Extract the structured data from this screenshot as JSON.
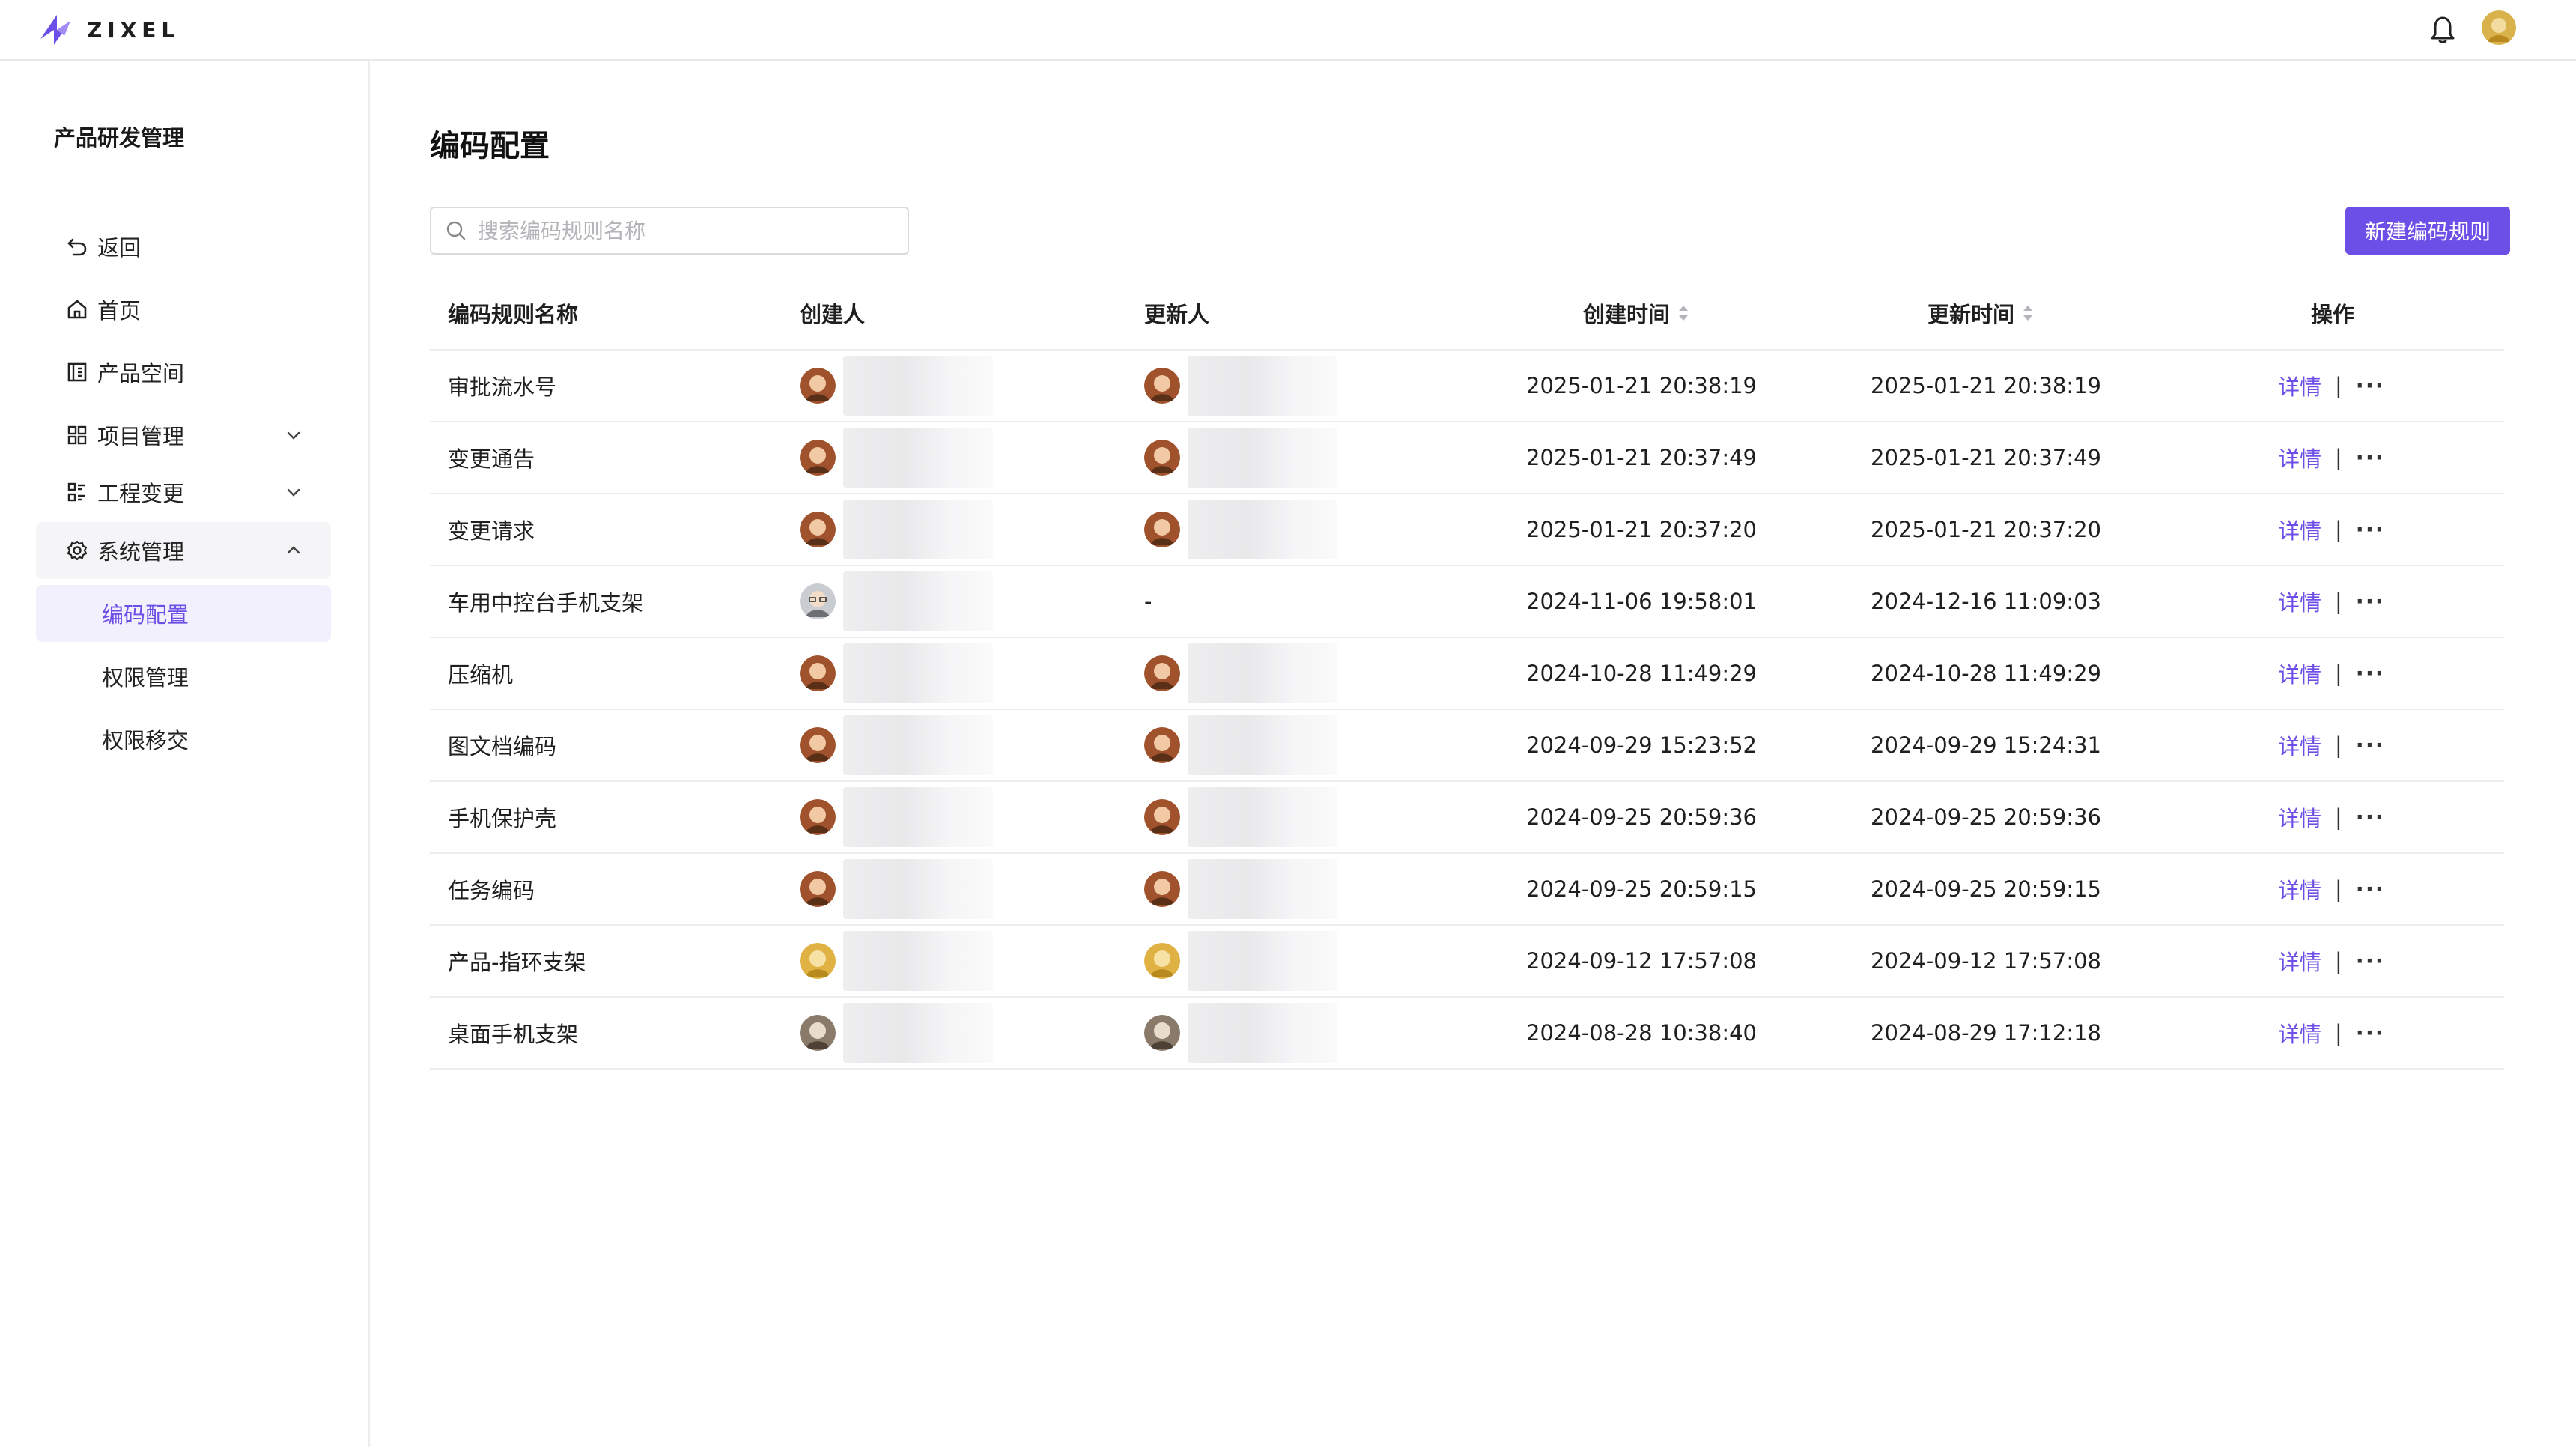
{
  "app": {
    "brand": "ZIXEL"
  },
  "sidebar": {
    "title": "产品研发管理",
    "items": [
      {
        "label": "返回",
        "icon": "undo-icon"
      },
      {
        "label": "首页",
        "icon": "home-icon"
      },
      {
        "label": "产品空间",
        "icon": "product-space-icon"
      },
      {
        "label": "项目管理",
        "icon": "grid-icon",
        "expandable": true,
        "expanded": false
      },
      {
        "label": "工程变更",
        "icon": "list-icon",
        "expandable": true,
        "expanded": false
      },
      {
        "label": "系统管理",
        "icon": "gear-icon",
        "expandable": true,
        "expanded": true
      }
    ],
    "subitems": [
      {
        "label": "编码配置",
        "selected": true
      },
      {
        "label": "权限管理",
        "selected": false
      },
      {
        "label": "权限移交",
        "selected": false
      }
    ]
  },
  "main": {
    "title": "编码配置",
    "search_placeholder": "搜索编码规则名称",
    "new_button": "新建编码规则",
    "columns": [
      "编码规则名称",
      "创建人",
      "更新人",
      "创建时间",
      "更新时间",
      "操作"
    ],
    "detail_label": "详情",
    "separator": "|",
    "more_label": "···",
    "rows": [
      {
        "name": "审批流水号",
        "creator_avatar": "brown",
        "updater_avatar": "brown",
        "updater": "",
        "created": "2025-01-21 20:38:19",
        "updated": "2025-01-21 20:38:19"
      },
      {
        "name": "变更通告",
        "creator_avatar": "brown",
        "updater_avatar": "brown",
        "updater": "",
        "created": "2025-01-21 20:37:49",
        "updated": "2025-01-21 20:37:49"
      },
      {
        "name": "变更请求",
        "creator_avatar": "brown",
        "updater_avatar": "brown",
        "updater": "",
        "created": "2025-01-21 20:37:20",
        "updated": "2025-01-21 20:37:20"
      },
      {
        "name": "车用中控台手机支架",
        "creator_avatar": "glasses",
        "updater_avatar": "",
        "updater": "-",
        "created": "2024-11-06 19:58:01",
        "updated": "2024-12-16 11:09:03"
      },
      {
        "name": "压缩机",
        "creator_avatar": "brown",
        "updater_avatar": "brown",
        "updater": "",
        "created": "2024-10-28 11:49:29",
        "updated": "2024-10-28 11:49:29"
      },
      {
        "name": "图文档编码",
        "creator_avatar": "brown",
        "updater_avatar": "brown",
        "updater": "",
        "created": "2024-09-29 15:23:52",
        "updated": "2024-09-29 15:24:31"
      },
      {
        "name": "手机保护壳",
        "creator_avatar": "brown",
        "updater_avatar": "brown",
        "updater": "",
        "created": "2024-09-25 20:59:36",
        "updated": "2024-09-25 20:59:36"
      },
      {
        "name": "任务编码",
        "creator_avatar": "brown",
        "updater_avatar": "brown",
        "updater": "",
        "created": "2024-09-25 20:59:15",
        "updated": "2024-09-25 20:59:15"
      },
      {
        "name": "产品-指环支架",
        "creator_avatar": "gold",
        "updater_avatar": "gold",
        "updater": "",
        "created": "2024-09-12 17:57:08",
        "updated": "2024-09-12 17:57:08"
      },
      {
        "name": "桌面手机支架",
        "creator_avatar": "dog",
        "updater_avatar": "dog",
        "updater": "",
        "created": "2024-08-28 10:38:40",
        "updated": "2024-08-29 17:12:18"
      }
    ]
  },
  "colors": {
    "accent": "#6c4fe6",
    "selected_bg": "#f2f0fd",
    "border": "#ededf0"
  }
}
